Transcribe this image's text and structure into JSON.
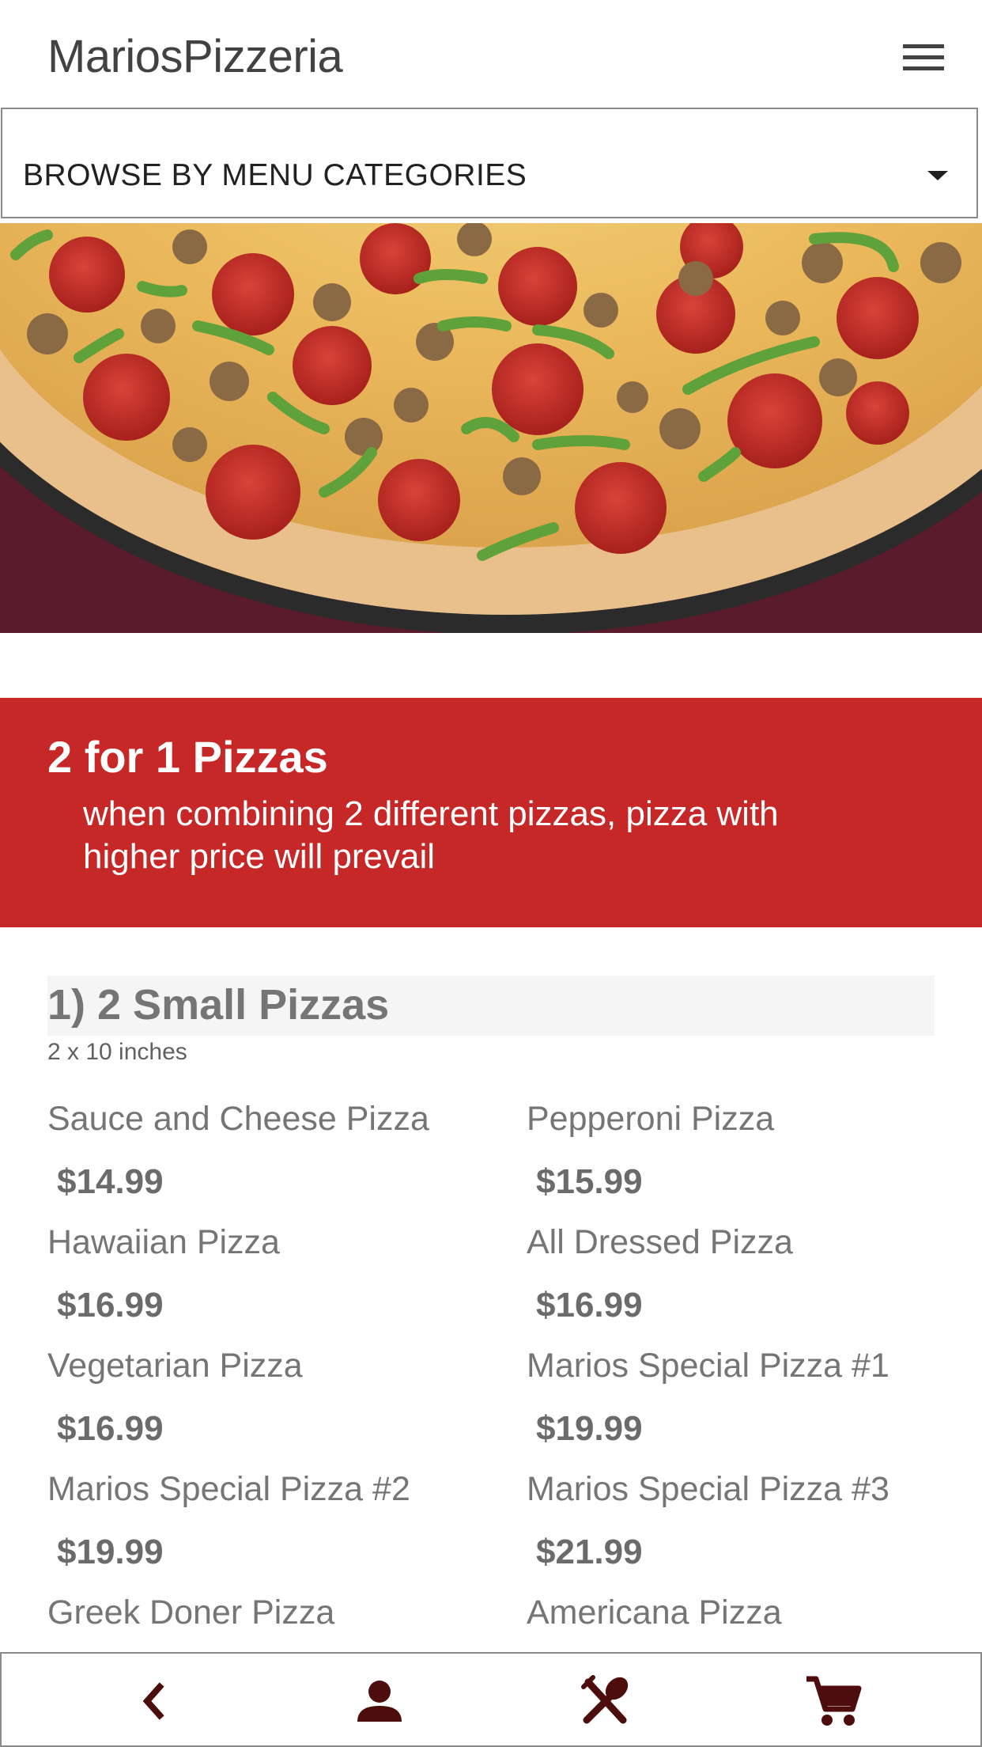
{
  "app": {
    "title": "MariosPizzeria"
  },
  "header": {
    "menu_icon": "hamburger-menu-icon"
  },
  "category_select": {
    "label": "BROWSE BY MENU CATEGORIES",
    "icon": "caret-down-icon"
  },
  "promo": {
    "title": "2 for 1 Pizzas",
    "description": "when combining 2 different pizzas, pizza with higher price will prevail",
    "background_color": "#c62828"
  },
  "section": {
    "title": "1)  2 Small Pizzas",
    "subtitle": "2 x 10 inches"
  },
  "items": [
    {
      "name": "Sauce and Cheese Pizza",
      "price": "$14.99"
    },
    {
      "name": "Pepperoni Pizza",
      "price": "$15.99"
    },
    {
      "name": "Hawaiian Pizza",
      "price": "$16.99"
    },
    {
      "name": "All Dressed Pizza",
      "price": "$16.99"
    },
    {
      "name": "Vegetarian Pizza",
      "price": "$16.99"
    },
    {
      "name": "Marios Special Pizza #1",
      "price": "$19.99"
    },
    {
      "name": "Marios Special Pizza #2",
      "price": "$19.99"
    },
    {
      "name": "Marios Special Pizza #3",
      "price": "$21.99"
    },
    {
      "name": "Greek Doner Pizza",
      "price": ""
    },
    {
      "name": "Americana Pizza",
      "price": ""
    }
  ],
  "bottom_nav": {
    "icons": [
      "back-chevron-icon",
      "person-icon",
      "utensils-icon",
      "cart-icon"
    ],
    "icon_color": "#4e0d0d"
  }
}
